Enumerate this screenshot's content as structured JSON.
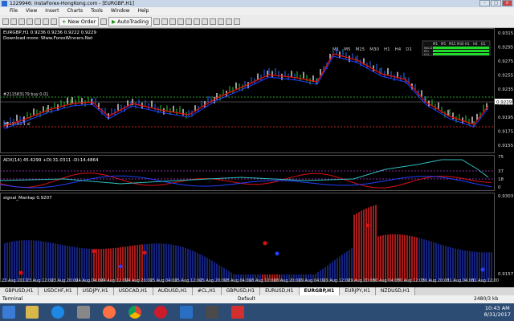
{
  "window": {
    "title": "1229946: InstaForex-HongKong.com - [EURGBP,H1]"
  },
  "menu": [
    "File",
    "View",
    "Insert",
    "Charts",
    "Tools",
    "Window",
    "Help"
  ],
  "toolbar": {
    "new_order": "New Order",
    "autotrading": "AutoTrading"
  },
  "chart": {
    "symbol_line": "EURGBP,H1 0.9236 0.9236 0.9222 0.9229",
    "download_note": "Download more: Www.ForexWinners.Net",
    "order_label_1": "#211583179 buy 0.01",
    "order_label_2": "#211583 1 sl",
    "price_axis": [
      "0.9315",
      "0.9295",
      "0.9275",
      "0.9255",
      "0.9235",
      "0.9215",
      "0.9195",
      "0.9175",
      "0.9155"
    ],
    "current_price": "0.9229",
    "timeframes": [
      "M1",
      "M5",
      "M15",
      "M30",
      "H1",
      "H4",
      "D1"
    ],
    "mtf_timeframes": [
      "M1",
      "M5",
      "M15",
      "M30",
      "H1",
      "H4",
      "D1"
    ],
    "mtf_rows": [
      "MACD",
      "RSI",
      "CCI"
    ],
    "adx_label": "ADX(14) 45.4299 +DI:31.0311 -DI:14.4864",
    "adx_axis": [
      "75",
      "37",
      "18",
      "0"
    ],
    "signal_label": "signal_Mantap 0.9207",
    "signal_axis": [
      "0.9303",
      "0.9157"
    ],
    "time_axis": [
      "23 Aug 2017",
      "23 Aug 12:00",
      "23 Aug 20:00",
      "24 Aug 04:00",
      "24 Aug 12:00",
      "24 Aug 20:00",
      "25 Aug 04:00",
      "25 Aug 12:00",
      "25 Aug 20:00",
      "28 Aug 04:00",
      "28 Aug 12:00",
      "28 Aug 20:00",
      "29 Aug 04:00",
      "29 Aug 12:00",
      "29 Aug 20:00",
      "30 Aug 04:00",
      "30 Aug 12:00",
      "30 Aug 20:00",
      "31 Aug 04:00",
      "31 Aug 12:00"
    ]
  },
  "tabs": [
    "GBPUSD,H1",
    "USDCHF,H1",
    "USDJPY,H1",
    "USDCAD,H1",
    "AUDUSD,H1",
    "#CL,H1",
    "GBPUSD,H1",
    "EURUSD,H1",
    "EURGBP,H1",
    "EURJPY,H1",
    "NZDUSD,H1"
  ],
  "active_tab": 8,
  "status": {
    "terminal": "Terminal",
    "profile": "Default",
    "traffic": "2480/3 kb"
  },
  "clock": {
    "time": "10:43 AM",
    "date": "8/31/2017"
  }
}
